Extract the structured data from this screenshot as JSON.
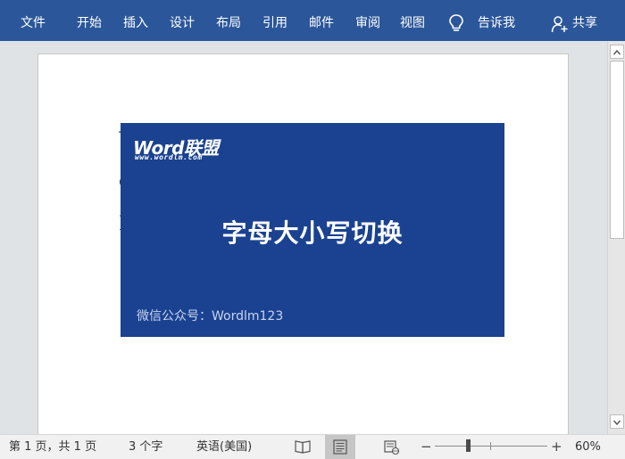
{
  "ribbon": {
    "color": "#2b579a",
    "tabs": [
      "文件",
      "开始",
      "插入",
      "设计",
      "布局",
      "引用",
      "邮件",
      "审阅",
      "视图"
    ],
    "tell_me": "告诉我",
    "tell_me_icon": "lightbulb-icon",
    "share": "共享",
    "share_icon": "person-plus-icon"
  },
  "document": {
    "banner": {
      "color": "#1a4291",
      "logo_word": "Word联盟",
      "logo_url": "www.wordlm.com",
      "title": "字母大小写切换",
      "footer": "微信公众号：Wordlm123"
    }
  },
  "status": {
    "page_info": "第 1 页，共 1 页",
    "word_count": "3 个字",
    "language": "英语(美国)",
    "zoom_minus": "−",
    "zoom_plus": "+",
    "zoom_level": "60%",
    "zoom_fraction": 0.3,
    "view_icons": [
      "read-mode-icon",
      "print-layout-icon",
      "web-layout-icon"
    ]
  }
}
